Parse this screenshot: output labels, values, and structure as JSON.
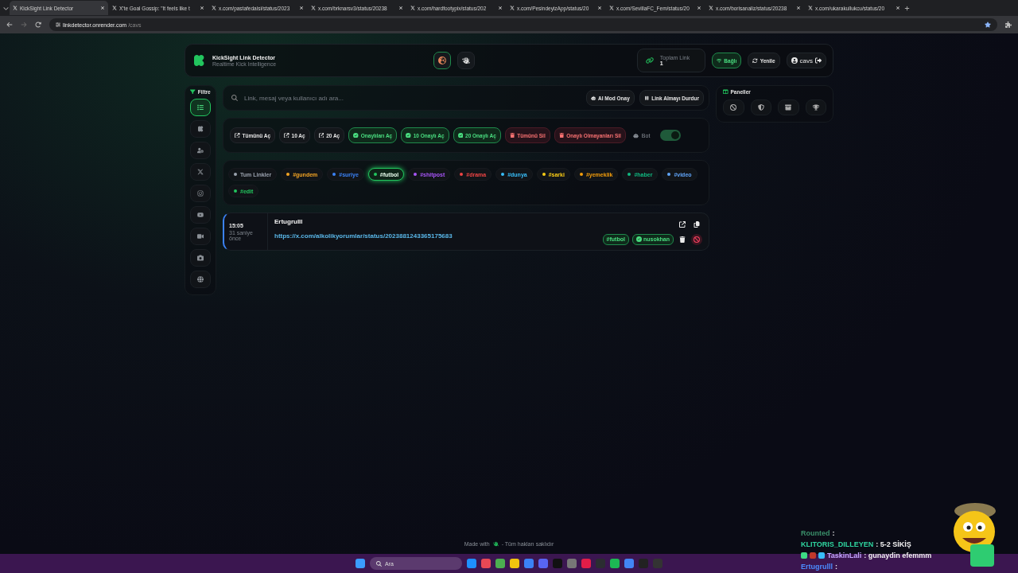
{
  "browser": {
    "tabs": [
      {
        "title": "KickSight Link Detector",
        "selected": true
      },
      {
        "title": "X'te Goal Gossip: \"It feels like t",
        "selected": false
      },
      {
        "title": "x.com/pastafedaisi/status/2023",
        "selected": false
      },
      {
        "title": "x.com/brknarsv3/status/20238",
        "selected": false
      },
      {
        "title": "x.com/hardfootypix/status/202",
        "selected": false
      },
      {
        "title": "x.com/PesindeyizApp/status/20",
        "selected": false
      },
      {
        "title": "x.com/SevillaFC_Fem/status/20",
        "selected": false
      },
      {
        "title": "x.com/borisanaliz/status/20238",
        "selected": false
      },
      {
        "title": "x.com/ukarakullukcu/status/20",
        "selected": false
      }
    ],
    "url": {
      "domain": "linkdetector.onrender.com",
      "path": "/cavs"
    }
  },
  "header": {
    "title": "KickSight Link Detector",
    "subtitle": "Realtime Kick Intelligence",
    "modes": [
      {
        "kind": "globe",
        "selected": true
      },
      {
        "kind": "hand",
        "selected": false
      }
    ],
    "stat": {
      "label": "Toplam Link",
      "value": "1"
    },
    "status": {
      "label": "Bağlı",
      "connected": true
    },
    "refresh": "Yenile",
    "user": "cavs"
  },
  "sidebar": {
    "title": "Filtre",
    "items": [
      {
        "kind": "all",
        "selected": true
      },
      {
        "kind": "kick",
        "selected": false
      },
      {
        "kind": "user",
        "selected": false
      },
      {
        "kind": "x",
        "selected": false
      },
      {
        "kind": "instagram",
        "selected": false
      },
      {
        "kind": "youtube",
        "selected": false
      },
      {
        "kind": "video",
        "selected": false
      },
      {
        "kind": "camera",
        "selected": false
      },
      {
        "kind": "web",
        "selected": false
      }
    ]
  },
  "search": {
    "placeholder": "Link, mesaj veya kullanıcı adı ara...",
    "buttons": [
      {
        "kind": "robot",
        "label": "AI Mod Onay"
      },
      {
        "kind": "pause",
        "label": "Link Almayı Durdur"
      }
    ]
  },
  "actions": [
    {
      "kind": "open",
      "label": "Tümünü Aç"
    },
    {
      "kind": "open",
      "label": "10 Aç"
    },
    {
      "kind": "open",
      "label": "20 Aç"
    },
    {
      "kind": "approved",
      "label": "Onaylıları Aç"
    },
    {
      "kind": "approved",
      "label": "10 Onaylı Aç"
    },
    {
      "kind": "approved",
      "label": "20 Onaylı Aç"
    },
    {
      "kind": "delete",
      "label": "Tümünü Sil"
    },
    {
      "kind": "delete",
      "label": "Onaylı Olmayanları Sil"
    }
  ],
  "bot": {
    "label": "Bot",
    "on": true
  },
  "tags": [
    {
      "label": "Tum Linkler",
      "color": "#9ca3af",
      "selected": false
    },
    {
      "label": "#gundem",
      "color": "#f5a524",
      "selected": false
    },
    {
      "label": "#suriye",
      "color": "#3b82f6",
      "selected": false
    },
    {
      "label": "#futbol",
      "color": "#22c55e",
      "selected": true
    },
    {
      "label": "#shitpost",
      "color": "#a855f7",
      "selected": false
    },
    {
      "label": "#drama",
      "color": "#ef4444",
      "selected": false
    },
    {
      "label": "#dunya",
      "color": "#38bdf8",
      "selected": false
    },
    {
      "label": "#sarki",
      "color": "#facc15",
      "selected": false
    },
    {
      "label": "#yemeklik",
      "color": "#f59e0b",
      "selected": false
    },
    {
      "label": "#haber",
      "color": "#10b981",
      "selected": false
    },
    {
      "label": "#video",
      "color": "#60a5fa",
      "selected": false
    },
    {
      "label": "#edit",
      "color": "#22c55e",
      "selected": false
    }
  ],
  "links": [
    {
      "time": "15:05",
      "ago": "31 saniye önce",
      "user": "Ertugrulll",
      "url": "https://x.com/alkolikyorumlar/status/2023881243365175683",
      "tag": "#futbol",
      "approver": "nusokhan"
    }
  ],
  "panels": {
    "title": "Paneller",
    "items": [
      {
        "kind": "ban"
      },
      {
        "kind": "shield"
      },
      {
        "kind": "archive"
      },
      {
        "kind": "trophy"
      }
    ]
  },
  "footer": {
    "before": "Made with",
    "after": "- Tüm hakları saklıdır"
  },
  "chat": [
    {
      "user": "Rounted",
      "text": ":",
      "color": "#3a8f6a"
    },
    {
      "user": "KLITORIS_DILLEYEN",
      "text": ": 5-2 SİKİŞ",
      "color": "#2fd6a0"
    },
    {
      "user": "TaskinLali",
      "text": ": gunaydin efemmm",
      "color": "#c4a7ff"
    },
    {
      "user": "Ertugrulll",
      "text": ":",
      "color": "#4b8cff"
    }
  ],
  "taskbar": {
    "search": "Ara"
  }
}
